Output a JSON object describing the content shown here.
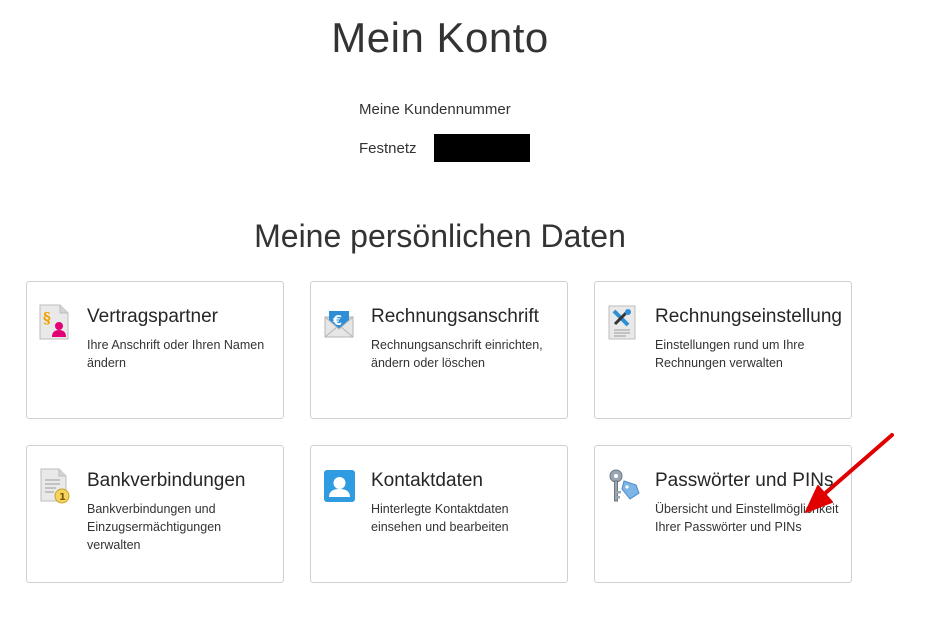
{
  "header": {
    "title": "Mein Konto",
    "customer_number_label": "Meine Kundennummer",
    "festnetz_label": "Festnetz"
  },
  "section": {
    "title": "Meine persönlichen Daten"
  },
  "tiles": [
    {
      "title": "Vertragspartner",
      "description": "Ihre Anschrift oder Ihren Namen ändern",
      "icon": "contract-partner-icon"
    },
    {
      "title": "Rechnungsanschrift",
      "description": "Rechnungsanschrift einrichten, ändern oder löschen",
      "icon": "billing-envelope-icon"
    },
    {
      "title": "Rechnungseinstellung",
      "description": "Einstellungen rund um Ihre Rechnungen verwalten",
      "icon": "billing-settings-icon"
    },
    {
      "title": "Bankverbindungen",
      "description": "Bankverbindungen und Einzugsermächtigungen verwalten",
      "icon": "bank-document-icon"
    },
    {
      "title": "Kontaktdaten",
      "description": "Hinterlegte Kontaktdaten einsehen und bearbeiten",
      "icon": "contact-card-icon"
    },
    {
      "title": "Passwörter und PINs",
      "description": "Übersicht und Einstellmöglichkeit Ihrer Passwörter und PINs",
      "icon": "key-tag-icon"
    }
  ],
  "colors": {
    "magenta": "#e20074",
    "annotation_arrow": "#e00000",
    "border": "#d0d0d0"
  }
}
